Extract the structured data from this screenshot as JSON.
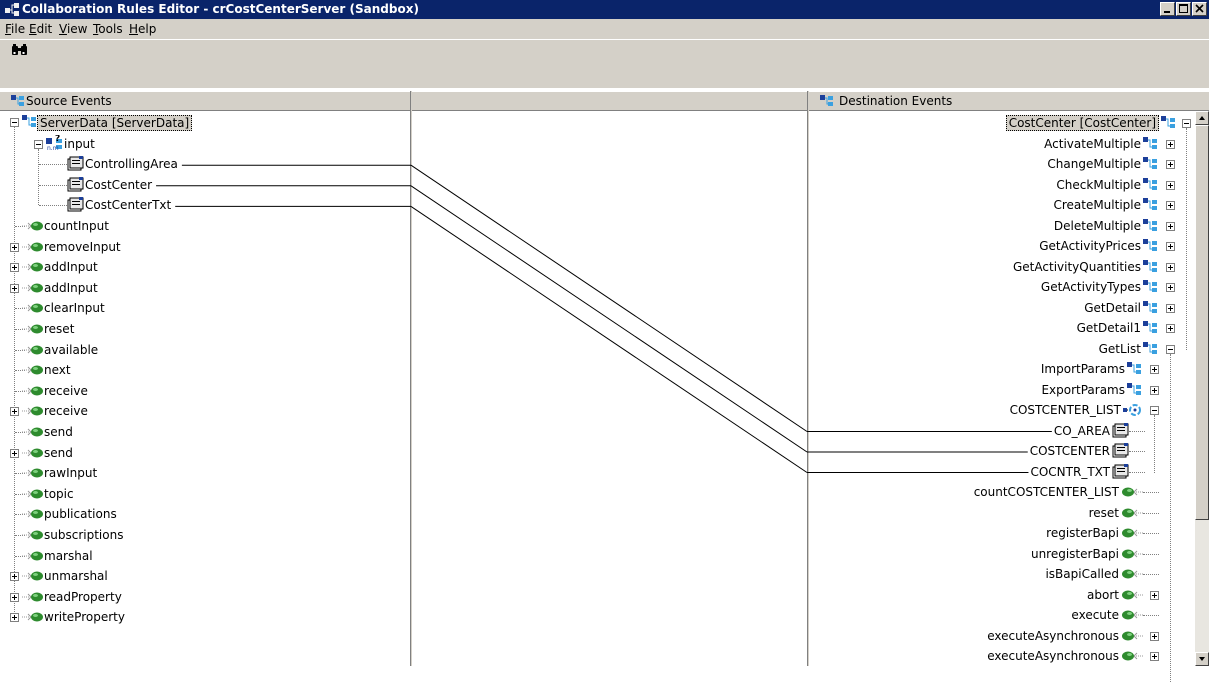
{
  "window": {
    "title": "Collaboration Rules Editor - crCostCenterServer (Sandbox)"
  },
  "menu": [
    {
      "label": "File",
      "mnemonic": "F",
      "rest": "ile"
    },
    {
      "label": "Edit",
      "mnemonic": "E",
      "rest": "dit"
    },
    {
      "label": "View",
      "mnemonic": "V",
      "rest": "iew"
    },
    {
      "label": "Tools",
      "mnemonic": "T",
      "rest": "ools"
    },
    {
      "label": "Help",
      "mnemonic": "H",
      "rest": "elp"
    }
  ],
  "toolbar": {
    "find_icon": "binoculars-icon"
  },
  "source": {
    "header": "Source Events",
    "root": "ServerData [ServerData]",
    "input_node": "input",
    "input_children": [
      "ControllingArea",
      "CostCenter",
      "CostCenterTxt"
    ],
    "methods": [
      {
        "label": "countInput",
        "expandable": false
      },
      {
        "label": "removeInput",
        "expandable": true
      },
      {
        "label": "addInput",
        "expandable": true
      },
      {
        "label": "addInput",
        "expandable": true
      },
      {
        "label": "clearInput",
        "expandable": false
      },
      {
        "label": "reset",
        "expandable": false
      },
      {
        "label": "available",
        "expandable": false
      },
      {
        "label": "next",
        "expandable": false
      },
      {
        "label": "receive",
        "expandable": false
      },
      {
        "label": "receive",
        "expandable": true
      },
      {
        "label": "send",
        "expandable": false
      },
      {
        "label": "send",
        "expandable": true
      },
      {
        "label": "rawInput",
        "expandable": false
      },
      {
        "label": "topic",
        "expandable": false
      },
      {
        "label": "publications",
        "expandable": false
      },
      {
        "label": "subscriptions",
        "expandable": false
      },
      {
        "label": "marshal",
        "expandable": false
      },
      {
        "label": "unmarshal",
        "expandable": true
      },
      {
        "label": "readProperty",
        "expandable": true
      },
      {
        "label": "writeProperty",
        "expandable": true
      }
    ]
  },
  "destination": {
    "header": "Destination Events",
    "root": "CostCenter [CostCenter]",
    "nodes": [
      {
        "label": "ActivateMultiple",
        "kind": "group",
        "level": 1,
        "state": "plus"
      },
      {
        "label": "ChangeMultiple",
        "kind": "group",
        "level": 1,
        "state": "plus"
      },
      {
        "label": "CheckMultiple",
        "kind": "group",
        "level": 1,
        "state": "plus"
      },
      {
        "label": "CreateMultiple",
        "kind": "group",
        "level": 1,
        "state": "plus"
      },
      {
        "label": "DeleteMultiple",
        "kind": "group",
        "level": 1,
        "state": "plus"
      },
      {
        "label": "GetActivityPrices",
        "kind": "group",
        "level": 1,
        "state": "plus"
      },
      {
        "label": "GetActivityQuantities",
        "kind": "group",
        "level": 1,
        "state": "plus"
      },
      {
        "label": "GetActivityTypes",
        "kind": "group",
        "level": 1,
        "state": "plus"
      },
      {
        "label": "GetDetail",
        "kind": "group",
        "level": 1,
        "state": "plus"
      },
      {
        "label": "GetDetail1",
        "kind": "group",
        "level": 1,
        "state": "plus"
      },
      {
        "label": "GetList",
        "kind": "group",
        "level": 1,
        "state": "minus"
      },
      {
        "label": "ImportParams",
        "kind": "group",
        "level": 2,
        "state": "plus"
      },
      {
        "label": "ExportParams",
        "kind": "group",
        "level": 2,
        "state": "plus"
      },
      {
        "label": "COSTCENTER_LIST",
        "kind": "table",
        "level": 2,
        "state": "minus"
      },
      {
        "label": "CO_AREA",
        "kind": "field",
        "level": 3,
        "state": "none"
      },
      {
        "label": "COSTCENTER",
        "kind": "field",
        "level": 3,
        "state": "none"
      },
      {
        "label": "COCNTR_TXT",
        "kind": "field",
        "level": 3,
        "state": "none"
      },
      {
        "label": "countCOSTCENTER_LIST",
        "kind": "method",
        "level": 2,
        "state": "none"
      },
      {
        "label": "reset",
        "kind": "method",
        "level": 2,
        "state": "none"
      },
      {
        "label": "registerBapi",
        "kind": "method",
        "level": 2,
        "state": "none"
      },
      {
        "label": "unregisterBapi",
        "kind": "method",
        "level": 2,
        "state": "none"
      },
      {
        "label": "isBapiCalled",
        "kind": "method",
        "level": 2,
        "state": "none"
      },
      {
        "label": "abort",
        "kind": "method",
        "level": 2,
        "state": "plus"
      },
      {
        "label": "execute",
        "kind": "method",
        "level": 2,
        "state": "none"
      },
      {
        "label": "executeAsynchronous",
        "kind": "method",
        "level": 2,
        "state": "plus"
      },
      {
        "label": "executeAsynchronous",
        "kind": "method",
        "level": 2,
        "state": "plus"
      }
    ]
  },
  "mappings": [
    {
      "from": "ControllingArea",
      "to": "CO_AREA"
    },
    {
      "from": "CostCenter",
      "to": "COSTCENTER"
    },
    {
      "from": "CostCenterTxt",
      "to": "COCNTR_TXT"
    }
  ],
  "colors": {
    "title_bar": "#0a246a",
    "chrome": "#d4d0c8",
    "method_icon_green": "#2e8b2e",
    "group_icon_blue": "#1c3f9a",
    "group_icon_cyan": "#3aa0e0"
  }
}
